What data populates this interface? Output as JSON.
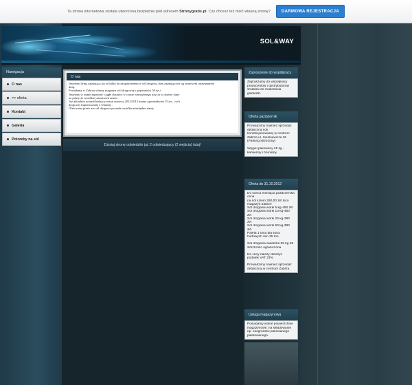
{
  "promo": {
    "text_prefix": "Ta strona internetowa została utworzona bezpłatnie pod adresem",
    "site": "Stronygratis.pl",
    "text_suffix": ". Czy chcesz też mieć własną stronę?",
    "button_label": "DARMOWA REJESTRACJA"
  },
  "header": {
    "title": "SOL&WAY"
  },
  "nav": {
    "title": "Nawigacja",
    "items": [
      {
        "label": "O nas"
      },
      {
        "label": "=> oferta"
      },
      {
        "label": "Kontakt"
      },
      {
        "label": "Galeria"
      },
      {
        "label": "Potrzeby na sól"
      }
    ]
  },
  "main": {
    "title": "O nas",
    "lines": [
      "Jesteśmy firmą zajmującą się od kilku lat zaopatrzeniem w sól drogową firm zajmujących się zimowym utrzymaniem",
      "dróg.",
      "Posiadamy w Zabrzu własny magazyn soli drogowej o pojemności 50 tys.t",
      "Jesteśmy w stanie zapewnić ciągłe dostawy w czasie wzmożonego użycia w okresie zimy",
      "na pokrycie wszelkiej zamówień umów .",
      "Już aktualnie na nadchodzący sezon zimowy 2012/2013 mamy zgromadzone 15 tys. t soli",
      "drogowej importowanej z Ukrainy .",
      "Oferowana przez nas sól drogowa posiada wszelkie niezbędne atesty."
    ],
    "visit_text": "Dzisiaj stronę odwiedziło już 2 odwiedzający (2 wejścia) tutaj!"
  },
  "sidebar": {
    "boxes": [
      {
        "title": "Zaproszenie do współpracy",
        "lines": [
          "Zapraszamy do współpracy",
          "producentów i dystrybutorów",
          "środków do zwalczania",
          "gołoledzi."
        ]
      },
      {
        "title": "Oferta październik",
        "lines": [
          "Prowadzimy również sprzedaż",
          "detaliczną soli",
          "konfekcjonowanej w centrum",
          "Zabrza ul. Sienkiewicza 36",
          "(Parking strzeżony)",
          "",
          "Węgiel pakowany 25 kg -",
          "kamienny i brunatny"
        ]
      },
      {
        "title": "Oferta do 31.10.2012",
        "lines": [
          "Do końca miesiąca października",
          "cena",
          "na sól luzem 290,00 zł/t loco",
          "magazyn Zabrze",
          "Sól drogowa worki 5 kg-490 zł/t",
          "Sól drogowa worki 10 kg-460",
          "zł/t",
          "Sól drogowa worki 25 kg-380",
          "zł/t",
          "Sól drogowa worki 50 kg-380",
          "zł/t",
          "Paleta 1 tona dla ilości",
          "hurtowych min 25 ton.",
          "",
          "Sól drogowa wiaderka 25 kg-25",
          "zł/szt ilość ograniczona",
          "",
          "Do ceny należy doliczyć",
          "podatek VAT 23%",
          "",
          "Prowadzimy również sprzedaż",
          "detaliczną w centrum Zabrza."
        ]
      },
      {
        "title": "Usługa magazynowa",
        "lines": [
          "Posiadamy wolne powierzchnie",
          "magazynowe, na składowanie",
          "np. ekogroszku pakowanego",
          "paletowanego."
        ]
      }
    ]
  }
}
